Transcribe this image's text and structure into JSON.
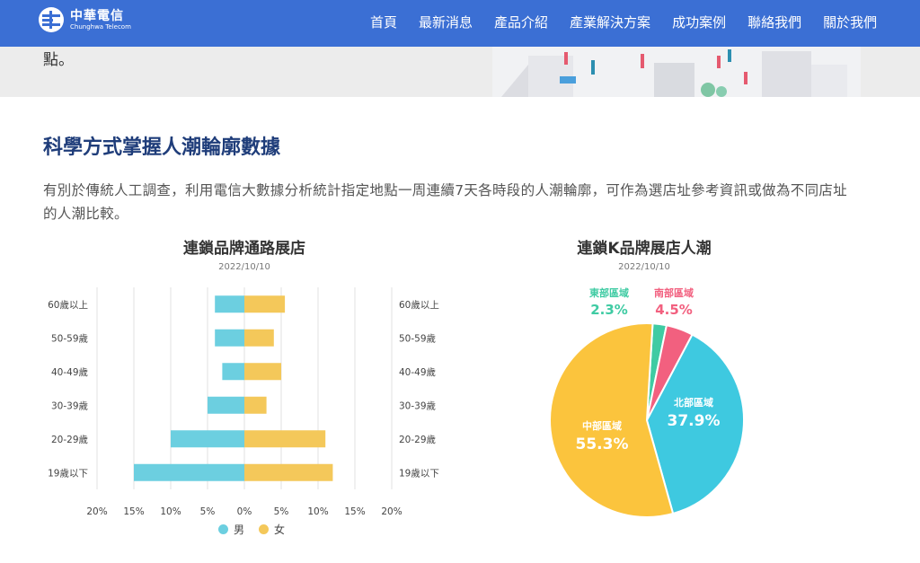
{
  "nav": {
    "logo": {
      "cn": "中華電信",
      "en": "Chunghwa Telecom"
    },
    "items": [
      {
        "label": "首頁"
      },
      {
        "label": "最新消息"
      },
      {
        "label": "產品介紹"
      },
      {
        "label": "產業解決方案"
      },
      {
        "label": "成功案例"
      },
      {
        "label": "聯絡我們"
      },
      {
        "label": "關於我們"
      }
    ]
  },
  "hero": {
    "text": "點。"
  },
  "section": {
    "title": "科學方式掌握人潮輪廓數據",
    "description": "有別於傳統人工調查，利用電信大數據分析統計指定地點一周連續7天各時段的人潮輪廓，可作為選店址參考資訊或做為不同店址的人潮比較。"
  },
  "colors": {
    "nav": "#3b6fd4",
    "male": "#6ccfe0",
    "female": "#f4c85a",
    "north": "#3ec9e0",
    "central": "#fbc43d",
    "east": "#3fcba3",
    "south": "#f2607f"
  },
  "chart_data": [
    {
      "type": "bar",
      "orientation": "horizontal-butterfly",
      "title": "連鎖品牌通路展店",
      "subtitle": "2022/10/10",
      "categories": [
        "60歲以上",
        "50-59歲",
        "40-49歲",
        "30-39歲",
        "20-29歲",
        "19歲以下"
      ],
      "series": [
        {
          "name": "男",
          "values": [
            4,
            4,
            3,
            5,
            10,
            15
          ]
        },
        {
          "name": "女",
          "values": [
            5.5,
            4,
            5,
            3,
            11,
            12
          ]
        }
      ],
      "xticks": [
        "20%",
        "15%",
        "10%",
        "5%",
        "0%",
        "5%",
        "10%",
        "15%",
        "20%"
      ],
      "xlim": [
        -20,
        20
      ],
      "grid": true,
      "legend": "bottom"
    },
    {
      "type": "pie",
      "title": "連鎖K品牌展店人潮",
      "subtitle": "2022/10/10",
      "slices": [
        {
          "name": "東部區域",
          "label": "2.3%",
          "value": 2.3
        },
        {
          "name": "南部區域",
          "label": "4.5%",
          "value": 4.5
        },
        {
          "name": "北部區域",
          "label": "37.9%",
          "value": 37.9
        },
        {
          "name": "中部區域",
          "label": "55.3%",
          "value": 55.3
        }
      ]
    }
  ]
}
